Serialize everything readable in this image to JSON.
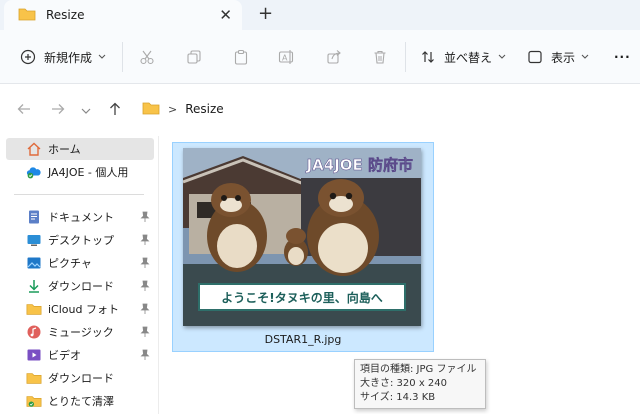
{
  "window": {
    "tab_title": "Resize",
    "close_glyph": "✕",
    "new_tab_glyph": "+"
  },
  "toolbar": {
    "new_label": "新規作成",
    "sort_label": "並べ替え",
    "view_label": "表示",
    "more_glyph": "···",
    "icons": [
      "plus-circle-icon",
      "cut-icon",
      "copy-icon",
      "paste-icon",
      "rename-icon",
      "share-icon",
      "delete-icon",
      "sort-icon",
      "view-icon"
    ]
  },
  "address": {
    "chevron": ">",
    "crumbs": [
      "Resize"
    ]
  },
  "sidebar": {
    "items": [
      {
        "label": "ホーム",
        "icon": "home-icon",
        "pinned": false,
        "active": true
      },
      {
        "label": "JA4JOE - 個人用",
        "icon": "cloud-icon",
        "pinned": false,
        "active": false
      },
      {
        "label": "ドキュメント",
        "icon": "documents-icon",
        "pinned": true,
        "active": false
      },
      {
        "label": "デスクトップ",
        "icon": "desktop-icon",
        "pinned": true,
        "active": false
      },
      {
        "label": "ピクチャ",
        "icon": "pictures-icon",
        "pinned": true,
        "active": false
      },
      {
        "label": "ダウンロード",
        "icon": "download-icon",
        "pinned": true,
        "active": false
      },
      {
        "label": "iCloud フォト",
        "icon": "folder-icon",
        "pinned": true,
        "active": false
      },
      {
        "label": "ミュージック",
        "icon": "music-icon",
        "pinned": true,
        "active": false
      },
      {
        "label": "ビデオ",
        "icon": "video-icon",
        "pinned": true,
        "active": false
      },
      {
        "label": "ダウンロード",
        "icon": "folder-icon",
        "pinned": false,
        "active": false
      },
      {
        "label": "とりたて清澤",
        "icon": "folder-icon",
        "pinned": false,
        "active": false
      }
    ]
  },
  "file": {
    "name": "DSTAR1_R.jpg",
    "thumb_title": "JA4JOE 防府市",
    "thumb_sign": "ようこそ!タヌキの里、向島へ"
  },
  "tooltip": {
    "line1": "項目の種類: JPG ファイル",
    "line2": "大きさ: 320 x 240",
    "line3": "サイズ: 14.3 KB"
  },
  "colors": {
    "accent": "#0067c0",
    "selection": "#cce8ff",
    "folder": "#f8c349"
  }
}
